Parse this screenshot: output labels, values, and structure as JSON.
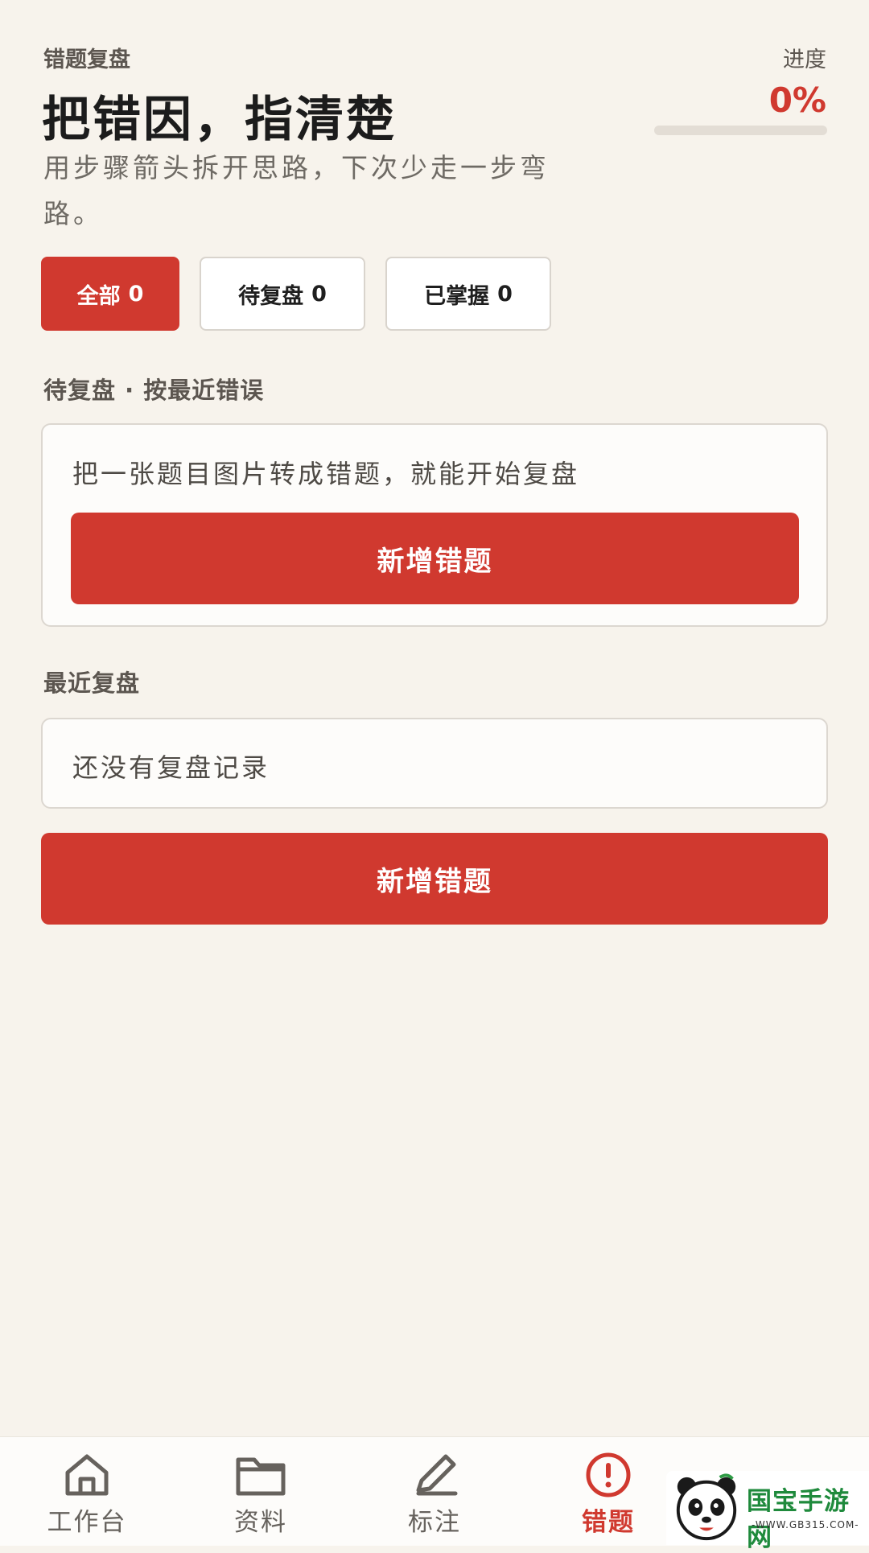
{
  "header": {
    "eyebrow": "错题复盘",
    "title": "把错因，指清楚",
    "subtitle": "用步骤箭头拆开思路，下次少走一步弯路。",
    "progress_label": "进度",
    "progress_value": "0%",
    "progress_fraction": 0
  },
  "filters": [
    {
      "label": "全部",
      "count": "0",
      "active": true
    },
    {
      "label": "待复盘",
      "count": "0",
      "active": false
    },
    {
      "label": "已掌握",
      "count": "0",
      "active": false
    }
  ],
  "pending": {
    "section_title": "待复盘 · 按最近错误",
    "empty_text": "把一张题目图片转成错题，就能开始复盘",
    "button_label": "新增错题"
  },
  "recent": {
    "section_title": "最近复盘",
    "empty_text": "还没有复盘记录",
    "button_label": "新增错题"
  },
  "tabbar": [
    {
      "label": "工作台",
      "icon": "home-icon",
      "active": false
    },
    {
      "label": "资料",
      "icon": "folder-icon",
      "active": false
    },
    {
      "label": "标注",
      "icon": "pen-icon",
      "active": false
    },
    {
      "label": "错题",
      "icon": "alert-circle-icon",
      "active": true
    }
  ],
  "watermark": {
    "title": "国宝手游网",
    "subtitle": "-WWW.GB315.COM-"
  },
  "colors": {
    "accent": "#d0392f",
    "background": "#f7f3ec"
  }
}
